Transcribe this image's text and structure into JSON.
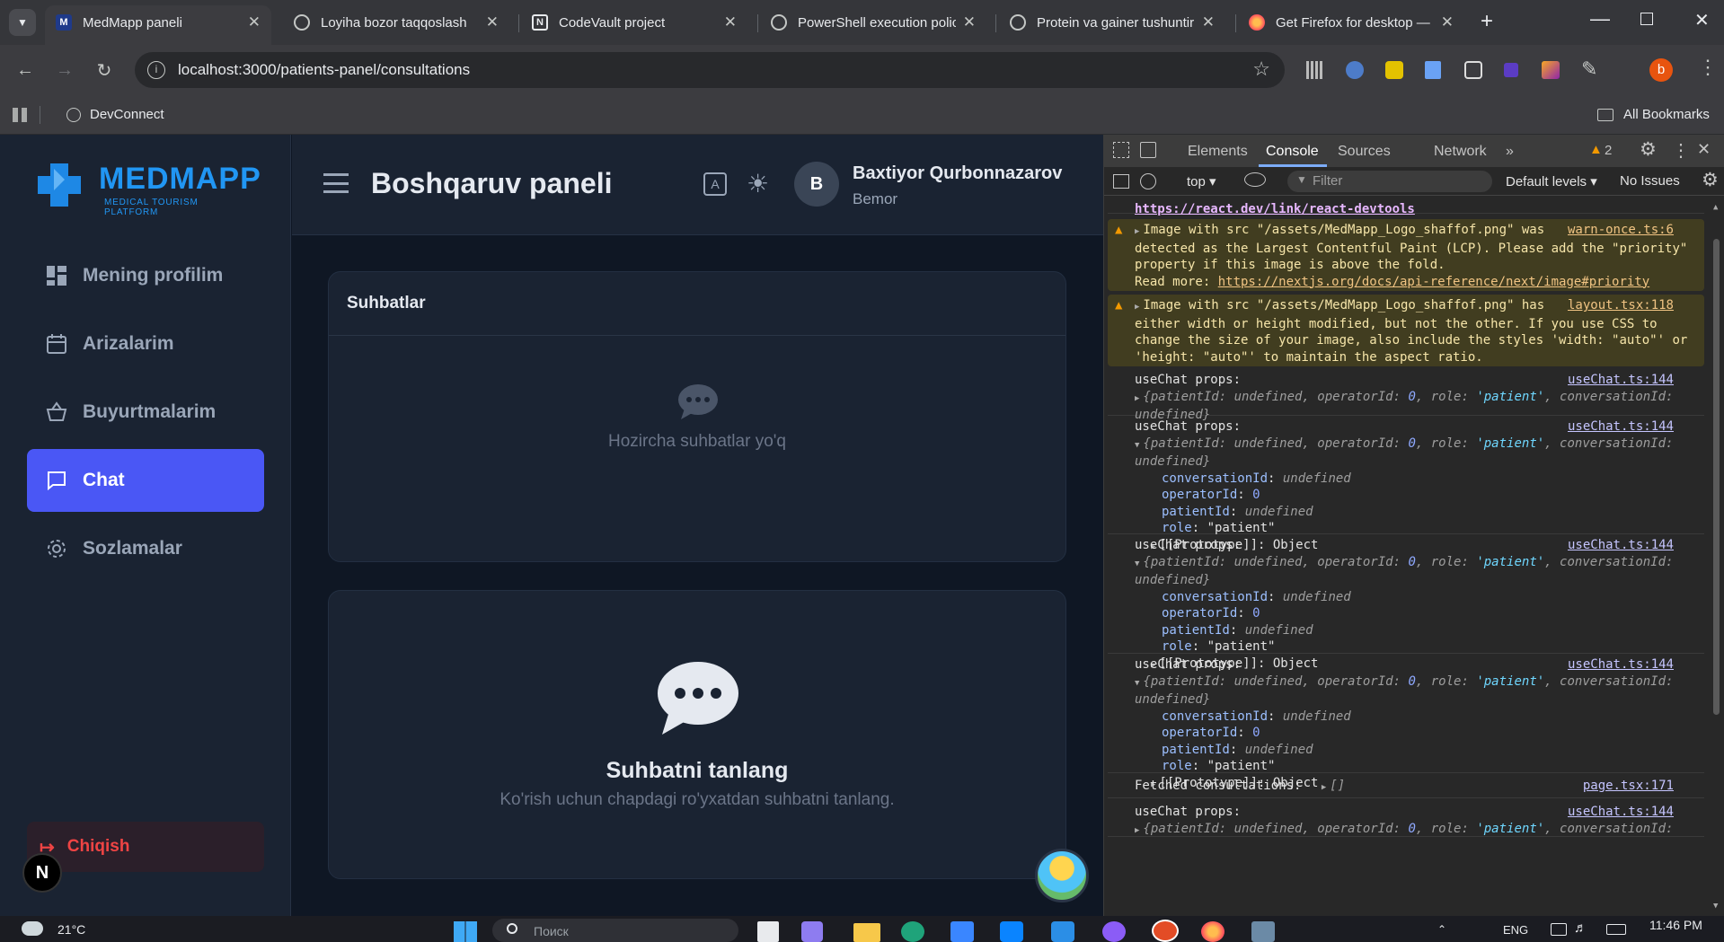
{
  "browser": {
    "tabs": [
      {
        "title": "MedMapp paneli",
        "icon": "medmapp-favicon",
        "active": true
      },
      {
        "title": "Loyiha bozor taqqoslash",
        "icon": "chatgpt-icon"
      },
      {
        "title": "CodeVault project",
        "icon": "notion-icon"
      },
      {
        "title": "PowerShell execution polic",
        "icon": "chatgpt-icon"
      },
      {
        "title": "Protein va gainer tushuntir",
        "icon": "chatgpt-icon"
      },
      {
        "title": "Get Firefox for desktop —",
        "icon": "firefox-icon"
      }
    ],
    "url": "localhost:3000/patients-panel/consultations",
    "bookmarks": {
      "item": "DevConnect",
      "all": "All Bookmarks"
    },
    "profile_initial": "b"
  },
  "app": {
    "logo": {
      "name": "MEDMAPP",
      "tagline": "MEDICAL TOURISM PLATFORM"
    },
    "nav": [
      {
        "label": "Mening profilim",
        "icon": "dashboard-icon"
      },
      {
        "label": "Arizalarim",
        "icon": "calendar-icon"
      },
      {
        "label": "Buyurtmalarim",
        "icon": "basket-icon"
      },
      {
        "label": "Chat",
        "icon": "chat-icon",
        "active": true
      },
      {
        "label": "Sozlamalar",
        "icon": "gear-icon"
      }
    ],
    "logout": "Chiqish",
    "next_badge": "N",
    "header": {
      "title": "Boshqaruv paneli",
      "user_initial": "B",
      "user_name": "Baxtiyor Qurbonnazarov",
      "user_role": "Bemor"
    },
    "conversations": {
      "title": "Suhbatlar",
      "empty": "Hozircha suhbatlar yo'q"
    },
    "select_panel": {
      "title": "Suhbatni tanlang",
      "subtitle": "Ko'rish uchun chapdagi ro'yxatdan suhbatni tanlang."
    }
  },
  "devtools": {
    "tabs": [
      "Elements",
      "Console",
      "Sources",
      "Network"
    ],
    "active_tab": "Console",
    "warn_count": "2",
    "context": "top",
    "filter_placeholder": "Filter",
    "levels": "Default levels",
    "issues": "No Issues",
    "messages": {
      "top_link": "https://react.dev/link/react-devtools",
      "warn1": {
        "src": "warn-once.ts:6",
        "lines": [
          "Image with src \"/assets/MedMapp_Logo_shaffof.png\" was",
          "detected as the Largest Contentful Paint (LCP). Please add the \"priority\"",
          "property if this image is above the fold."
        ],
        "readmore": "Read more: ",
        "link": "https://nextjs.org/docs/api-reference/next/image#priority"
      },
      "warn2": {
        "src": "layout.tsx:118",
        "lines": [
          "Image with src \"/assets/MedMapp_Logo_shaffof.png\" has",
          "either width or height modified, but not the other. If you use CSS to",
          "change the size of your image, also include the styles 'width: \"auto\"' or",
          "'height: \"auto\"' to maintain the aspect ratio."
        ]
      },
      "usechat_label": "useChat props:",
      "usechat_src": "useChat.ts:144",
      "fetched_label": "Fetched consultations:",
      "fetched_value": "[]",
      "fetched_src": "page.tsx:171"
    }
  },
  "taskbar": {
    "weather": "21°C",
    "search": "Поиск",
    "lang": "ENG",
    "time": "11:46 PM"
  }
}
